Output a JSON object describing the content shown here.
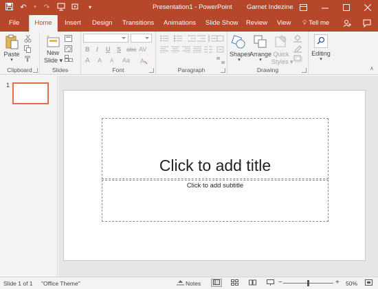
{
  "window": {
    "title": "Presentation1 - PowerPoint",
    "user": "Garnet Indezine"
  },
  "qat": {
    "icons": [
      "save-icon",
      "undo-icon",
      "redo-icon",
      "slideshow-from-start-icon",
      "customize-qat-icon"
    ]
  },
  "tabs": [
    {
      "label": "File"
    },
    {
      "label": "Home"
    },
    {
      "label": "Insert"
    },
    {
      "label": "Design"
    },
    {
      "label": "Transitions"
    },
    {
      "label": "Animations"
    },
    {
      "label": "Slide Show"
    },
    {
      "label": "Review"
    },
    {
      "label": "View"
    }
  ],
  "tell_me": "Tell me",
  "ribbon": {
    "clipboard": {
      "label": "Clipboard",
      "paste": "Paste"
    },
    "slides": {
      "label": "Slides",
      "new_slide_line1": "New",
      "new_slide_line2": "Slide"
    },
    "font": {
      "label": "Font",
      "bold": "B",
      "italic": "I",
      "underline": "U",
      "strike": "S",
      "abc": "abc",
      "char_spacing": "AV",
      "grow": "A",
      "shrink": "A",
      "case": "Aa",
      "clear": "A"
    },
    "paragraph": {
      "label": "Paragraph"
    },
    "drawing": {
      "label": "Drawing",
      "shapes": "Shapes",
      "arrange": "Arrange",
      "quick_styles_line1": "Quick",
      "quick_styles_line2": "Styles"
    },
    "editing": {
      "label": "Editing"
    }
  },
  "thumbnails": [
    {
      "number": "1"
    }
  ],
  "slide": {
    "title_placeholder": "Click to add title",
    "subtitle_placeholder": "Click to add subtitle"
  },
  "status": {
    "slide_info": "Slide 1 of 1",
    "theme": "\"Office Theme\"",
    "notes": "Notes",
    "zoom": "50%",
    "zoom_minus": "−",
    "zoom_plus": "+",
    "zoom_level_fraction": 0.5
  },
  "colors": {
    "accent": "#b7472a",
    "thumb_border": "#e46c4a"
  }
}
